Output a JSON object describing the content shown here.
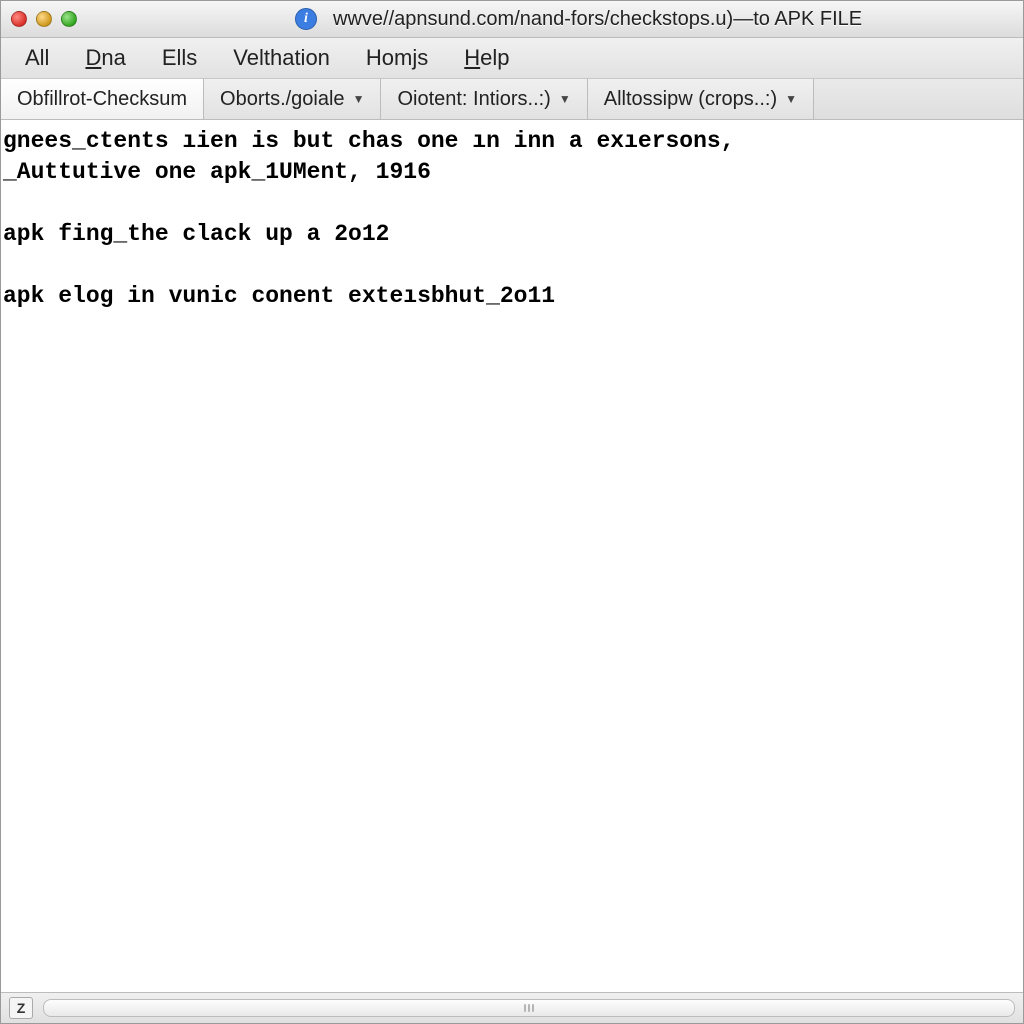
{
  "title": "wwve//apnsund.com/nand-fors/checkstops.u)—to APK FILE",
  "info_icon_glyph": "i",
  "menubar": [
    {
      "label": "All",
      "underline_index": -1
    },
    {
      "label": "Dna",
      "underline_index": 0
    },
    {
      "label": "Ells",
      "underline_index": -1
    },
    {
      "label": "Velthation",
      "underline_index": -1
    },
    {
      "label": "Homjs",
      "underline_index": -1
    },
    {
      "label": "Help",
      "underline_index": 0
    }
  ],
  "tabs": [
    {
      "label": "Obfillrot-Checksum",
      "active": true,
      "has_dropdown": false
    },
    {
      "label": "Oborts./goiale",
      "active": false,
      "has_dropdown": true
    },
    {
      "label": "Oiotent: Intiors..:)",
      "active": false,
      "has_dropdown": true
    },
    {
      "label": "Alltossipw (crops..:)",
      "active": false,
      "has_dropdown": true
    }
  ],
  "content_lines": [
    "gnees_ctents ıien is but chas one ın inn a exıersons,",
    "_Auttutive one apk_1UMent, 1916",
    "",
    "apk fing_the clack up a 2o12",
    "",
    "apk elog in vunic conent exteısbhut_2o11"
  ],
  "statusbar": {
    "z_label": "Z"
  }
}
